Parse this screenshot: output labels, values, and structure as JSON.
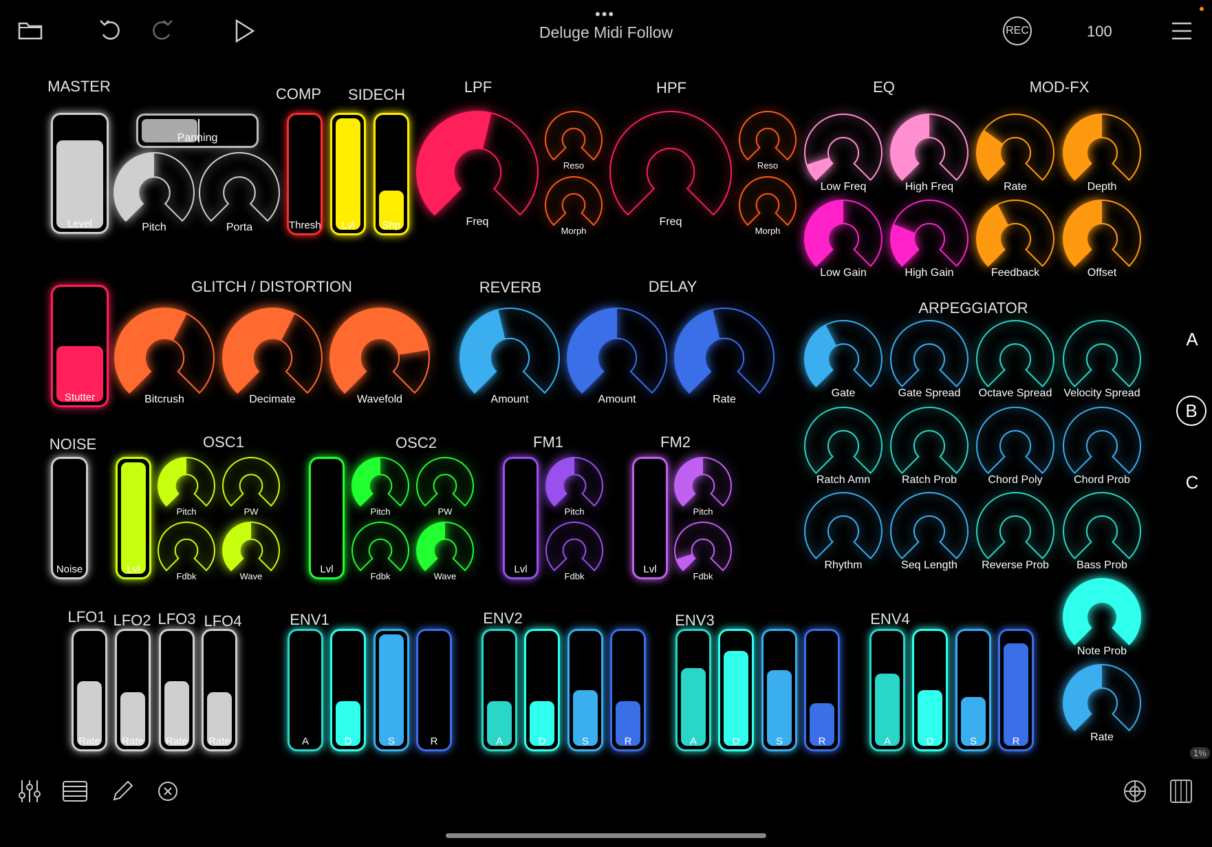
{
  "topbar": {
    "title": "Deluge Midi Follow",
    "rec_label": "REC",
    "tempo": "100",
    "icons": [
      "folder-icon",
      "undo-icon",
      "redo-icon",
      "play-icon",
      "menu-icon"
    ]
  },
  "sections": {
    "master": "MASTER",
    "comp": "COMP",
    "sidech": "SIDECH",
    "lpf": "LPF",
    "hpf": "HPF",
    "eq": "EQ",
    "modfx": "MOD-FX",
    "glitch": "GLITCH / DISTORTION",
    "reverb": "REVERB",
    "delay": "DELAY",
    "arp": "ARPEGGIATOR",
    "noise": "NOISE",
    "osc1": "OSC1",
    "osc2": "OSC2",
    "fm1": "FM1",
    "fm2": "FM2",
    "lfo1": "LFO1",
    "lfo2": "LFO2",
    "lfo3": "LFO3",
    "lfo4": "LFO4",
    "env1": "ENV1",
    "env2": "ENV2",
    "env3": "ENV3",
    "env4": "ENV4"
  },
  "colors": {
    "white": "#cfcfcf",
    "red": "#ff2a2a",
    "yellow": "#ffee00",
    "pink": "#ff1f5a",
    "orangered": "#ff5a1a",
    "lightpink": "#ff8fd0",
    "magenta": "#ff22c8",
    "orange": "#ff9a10",
    "glitch": "#ff6a30",
    "sky": "#3aaeee",
    "blue": "#3a6fe8",
    "teal": "#2ad6c8",
    "lime": "#c8ff10",
    "green": "#22ff30",
    "purple": "#9950ee",
    "violet": "#c060f0",
    "cyan": "#30ffee"
  },
  "knobs": [
    {
      "id": "pitch",
      "label": "Pitch",
      "value": 0.5,
      "color": "white"
    },
    {
      "id": "porta",
      "label": "Porta",
      "value": 0,
      "color": "white"
    },
    {
      "id": "lpf-freq",
      "label": "Freq",
      "value": 0.55,
      "color": "pink"
    },
    {
      "id": "lpf-reso",
      "label": "Reso",
      "value": 0,
      "color": "orangered"
    },
    {
      "id": "lpf-morph",
      "label": "Morph",
      "value": 0,
      "color": "orangered"
    },
    {
      "id": "hpf-freq",
      "label": "Freq",
      "value": 0,
      "color": "pink"
    },
    {
      "id": "hpf-reso",
      "label": "Reso",
      "value": 0,
      "color": "orangered"
    },
    {
      "id": "hpf-morph",
      "label": "Morph",
      "value": 0,
      "color": "orangered"
    },
    {
      "id": "eq-lowfreq",
      "label": "Low Freq",
      "value": 0.1,
      "color": "lightpink"
    },
    {
      "id": "eq-highfreq",
      "label": "High Freq",
      "value": 0.5,
      "color": "lightpink"
    },
    {
      "id": "eq-lowgain",
      "label": "Low Gain",
      "value": 0.5,
      "color": "magenta"
    },
    {
      "id": "eq-highgain",
      "label": "High Gain",
      "value": 0.25,
      "color": "magenta"
    },
    {
      "id": "modfx-rate",
      "label": "Rate",
      "value": 0.3,
      "color": "orange"
    },
    {
      "id": "modfx-depth",
      "label": "Depth",
      "value": 0.5,
      "color": "orange"
    },
    {
      "id": "modfx-feedback",
      "label": "Feedback",
      "value": 0.4,
      "color": "orange"
    },
    {
      "id": "modfx-offset",
      "label": "Offset",
      "value": 0.5,
      "color": "orange"
    },
    {
      "id": "bitcrush",
      "label": "Bitcrush",
      "value": 0.6,
      "color": "glitch"
    },
    {
      "id": "decimate",
      "label": "Decimate",
      "value": 0.6,
      "color": "glitch"
    },
    {
      "id": "wavefold",
      "label": "Wavefold",
      "value": 0.8,
      "color": "glitch"
    },
    {
      "id": "reverb-amount",
      "label": "Amount",
      "value": 0.45,
      "color": "sky"
    },
    {
      "id": "delay-amount",
      "label": "Amount",
      "value": 0.5,
      "color": "blue"
    },
    {
      "id": "delay-rate",
      "label": "Rate",
      "value": 0.45,
      "color": "blue"
    },
    {
      "id": "arp-gate",
      "label": "Gate",
      "value": 0.4,
      "color": "sky"
    },
    {
      "id": "arp-gatespread",
      "label": "Gate Spread",
      "value": 0,
      "color": "sky"
    },
    {
      "id": "arp-octavespread",
      "label": "Octave Spread",
      "value": 0,
      "color": "teal"
    },
    {
      "id": "arp-velspread",
      "label": "Velocity Spread",
      "value": 0,
      "color": "teal"
    },
    {
      "id": "arp-ratchamn",
      "label": "Ratch Amn",
      "value": 0,
      "color": "teal"
    },
    {
      "id": "arp-ratchprob",
      "label": "Ratch Prob",
      "value": 0,
      "color": "teal"
    },
    {
      "id": "arp-chordpoly",
      "label": "Chord Poly",
      "value": 0,
      "color": "sky"
    },
    {
      "id": "arp-chordprob",
      "label": "Chord Prob",
      "value": 0,
      "color": "sky"
    },
    {
      "id": "arp-rhythm",
      "label": "Rhythm",
      "value": 0,
      "color": "sky"
    },
    {
      "id": "arp-seqlength",
      "label": "Seq Length",
      "value": 0,
      "color": "sky"
    },
    {
      "id": "arp-reverseprob",
      "label": "Reverse Prob",
      "value": 0,
      "color": "teal"
    },
    {
      "id": "arp-bassprob",
      "label": "Bass Prob",
      "value": 0,
      "color": "teal"
    },
    {
      "id": "arp-noteprob",
      "label": "Note Prob",
      "value": 1,
      "color": "cyan"
    },
    {
      "id": "arp-rate",
      "label": "Rate",
      "value": 0.5,
      "color": "sky"
    },
    {
      "id": "osc1-pitch",
      "label": "Pitch",
      "value": 0.5,
      "color": "lime"
    },
    {
      "id": "osc1-pw",
      "label": "PW",
      "value": 0,
      "color": "lime"
    },
    {
      "id": "osc1-fdbk",
      "label": "Fdbk",
      "value": 0,
      "color": "lime"
    },
    {
      "id": "osc1-wave",
      "label": "Wave",
      "value": 0.5,
      "color": "lime"
    },
    {
      "id": "osc2-pitch",
      "label": "Pitch",
      "value": 0.5,
      "color": "green"
    },
    {
      "id": "osc2-pw",
      "label": "PW",
      "value": 0,
      "color": "green"
    },
    {
      "id": "osc2-fdbk",
      "label": "Fdbk",
      "value": 0,
      "color": "green"
    },
    {
      "id": "osc2-wave",
      "label": "Wave",
      "value": 0.5,
      "color": "green"
    },
    {
      "id": "fm1-pitch",
      "label": "Pitch",
      "value": 0.5,
      "color": "purple"
    },
    {
      "id": "fm1-fdbk",
      "label": "Fdbk",
      "value": 0,
      "color": "purple"
    },
    {
      "id": "fm2-pitch",
      "label": "Pitch",
      "value": 0.5,
      "color": "violet"
    },
    {
      "id": "fm2-fdbk",
      "label": "Fdbk",
      "value": 0.1,
      "color": "violet"
    }
  ],
  "faders": [
    {
      "id": "master-level",
      "label": "Level",
      "value": 0.8,
      "color": "white"
    },
    {
      "id": "comp-thresh",
      "label": "Thresh",
      "value": 0,
      "color": "red"
    },
    {
      "id": "sidech-lvl",
      "label": "Lvl",
      "value": 1,
      "color": "yellow"
    },
    {
      "id": "sidech-shp",
      "label": "Shp",
      "value": 0.35,
      "color": "yellow"
    },
    {
      "id": "stutter",
      "label": "Stutter",
      "value": 0.5,
      "color": "pink"
    },
    {
      "id": "noise",
      "label": "Noise",
      "value": 0,
      "color": "white"
    },
    {
      "id": "osc1-lvl",
      "label": "Lvl",
      "value": 1,
      "color": "lime"
    },
    {
      "id": "osc2-lvl",
      "label": "Lvl",
      "value": 0,
      "color": "green"
    },
    {
      "id": "fm1-lvl",
      "label": "Lvl",
      "value": 0,
      "color": "purple"
    },
    {
      "id": "fm2-lvl",
      "label": "Lvl",
      "value": 0,
      "color": "violet"
    },
    {
      "id": "lfo1-rate",
      "label": "Rate",
      "value": 0.58,
      "color": "white"
    },
    {
      "id": "lfo2-rate",
      "label": "Rate",
      "value": 0.48,
      "color": "white"
    },
    {
      "id": "lfo3-rate",
      "label": "Rate",
      "value": 0.58,
      "color": "white"
    },
    {
      "id": "lfo4-rate",
      "label": "Rate",
      "value": 0.48,
      "color": "white"
    },
    {
      "id": "env1-a",
      "label": "A",
      "value": 0,
      "color": "teal"
    },
    {
      "id": "env1-d",
      "label": "D",
      "value": 0.4,
      "color": "cyan"
    },
    {
      "id": "env1-s",
      "label": "S",
      "value": 1,
      "color": "sky"
    },
    {
      "id": "env1-r",
      "label": "R",
      "value": 0,
      "color": "blue"
    },
    {
      "id": "env2-a",
      "label": "A",
      "value": 0.4,
      "color": "teal"
    },
    {
      "id": "env2-d",
      "label": "D",
      "value": 0.4,
      "color": "cyan"
    },
    {
      "id": "env2-s",
      "label": "S",
      "value": 0.5,
      "color": "sky"
    },
    {
      "id": "env2-r",
      "label": "R",
      "value": 0.4,
      "color": "blue"
    },
    {
      "id": "env3-a",
      "label": "A",
      "value": 0.7,
      "color": "teal"
    },
    {
      "id": "env3-d",
      "label": "D",
      "value": 0.85,
      "color": "cyan"
    },
    {
      "id": "env3-s",
      "label": "S",
      "value": 0.68,
      "color": "sky"
    },
    {
      "id": "env3-r",
      "label": "R",
      "value": 0.38,
      "color": "blue"
    },
    {
      "id": "env4-a",
      "label": "A",
      "value": 0.65,
      "color": "teal"
    },
    {
      "id": "env4-d",
      "label": "D",
      "value": 0.5,
      "color": "cyan"
    },
    {
      "id": "env4-s",
      "label": "S",
      "value": 0.44,
      "color": "sky"
    },
    {
      "id": "env4-r",
      "label": "R",
      "value": 0.92,
      "color": "blue"
    }
  ],
  "panning": {
    "label": "Panning",
    "value": 0.5
  },
  "side_tabs": [
    "A",
    "B",
    "C"
  ],
  "side_badge": "1%",
  "bottombar": {
    "icons": [
      "mixer-icon",
      "list-icon",
      "pencil-icon",
      "close-circle-icon",
      "globe-icon",
      "keyboard-icon"
    ]
  }
}
